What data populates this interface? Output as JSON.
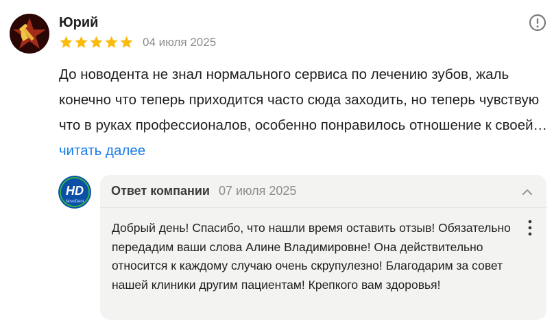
{
  "review": {
    "author": "Юрий",
    "rating": 5,
    "rating_max": 5,
    "date": "04 июля 2025",
    "text": "До новодента не знал нормального сервиса по лечению зубов, жаль конечно что теперь приходится часто сюда заходить, но теперь чувствую что в руках профессионалов, особенно понравилось отношение к своей…",
    "read_more": "читать далее",
    "star_color": "#fbbb0d"
  },
  "reply": {
    "title": "Ответ компании",
    "date": "07 июля 2025",
    "text": "Добрый день! Спасибо, что нашли время оставить отзыв! Обязательно передадим ваши слова Алине Владимировне! Она действительно относится к каждому случаю очень скрупулезно! Благодарим за совет нашей клиники другим пациентам! Крепкого вам здоровья!",
    "logo_text": "NovoDent",
    "logo_letters": "HD"
  },
  "icons": {
    "report": "exclamation-circle-icon",
    "collapse": "chevron-up-icon",
    "more": "vertical-dots-icon"
  },
  "colors": {
    "link": "#1a7de8",
    "muted": "#8c8c8c",
    "card_bg": "#f3f3f2"
  }
}
